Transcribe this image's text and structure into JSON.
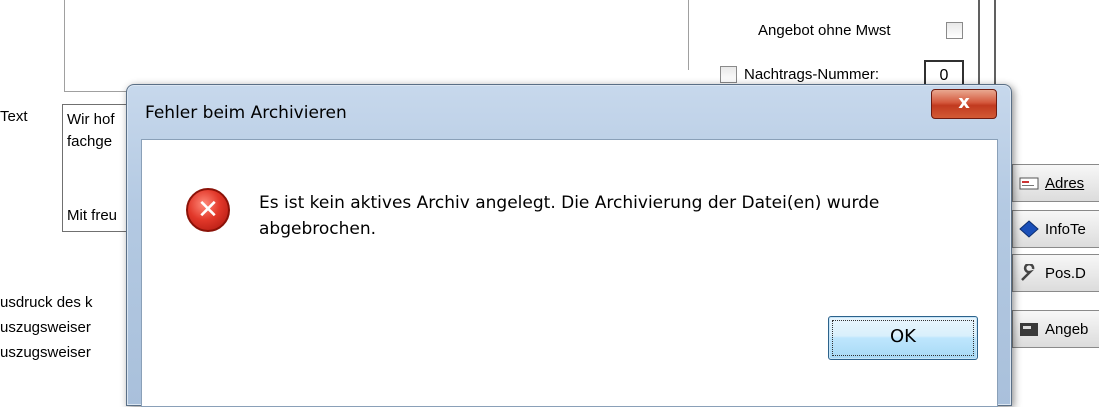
{
  "background": {
    "angebot_ohne_mwst_label": "Angebot ohne Mwst",
    "nachtrags_nummer_label": "Nachtrags-Nummer:",
    "nachtrags_nummer_value": "0",
    "text_label": "Text",
    "textarea_lines": [
      "Wir hof",
      "fachge",
      "Mit freu"
    ],
    "print_options": [
      "usdruck des k",
      "uszugsweiser",
      "uszugsweiser"
    ],
    "side_buttons": [
      {
        "label": "Adres",
        "icon": "address-card-icon"
      },
      {
        "label": "InfoTe",
        "icon": "info-diamond-icon"
      },
      {
        "label": "Pos.D",
        "icon": "wrench-icon"
      },
      {
        "label": "Angeb",
        "icon": "offer-folder-icon"
      }
    ]
  },
  "dialog": {
    "title": "Fehler beim Archivieren",
    "close_label": "x",
    "icon": "error-icon",
    "message": "Es ist kein aktives Archiv angelegt. Die Archivierung der Datei(en) wurde abgebrochen.",
    "ok_label": "OK"
  },
  "colors": {
    "dialog_frame": "#b3c9e2",
    "close_button": "#c13a1f",
    "error_icon": "#e2382a",
    "ok_button": "#bee6fd"
  }
}
